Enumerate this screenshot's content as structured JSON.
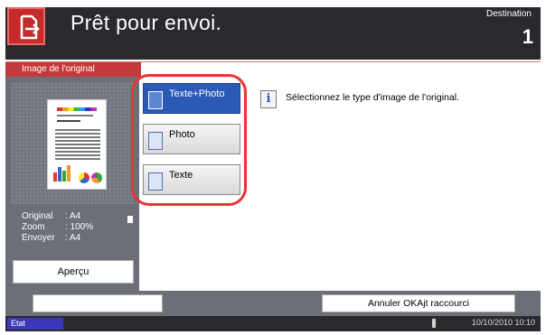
{
  "header": {
    "title": "Prêt pour envoi.",
    "destination_label": "Destination",
    "destination_count": "1"
  },
  "section": {
    "title": "Image de l'original"
  },
  "preview": {
    "info": [
      {
        "label": "Original",
        "value": ": A4"
      },
      {
        "label": "Zoom",
        "value": ": 100%"
      },
      {
        "label": "Envoyer",
        "value": ": A4"
      }
    ],
    "apercu_label": "Aperçu"
  },
  "options": [
    {
      "label": "Texte+Photo",
      "selected": true
    },
    {
      "label": "Photo",
      "selected": false
    },
    {
      "label": "Texte",
      "selected": false
    }
  ],
  "message": {
    "icon": "info-icon",
    "text": "Sélectionnez le type d'image de l'original."
  },
  "footer": {
    "right_button_label": "Annuler OKAjt raccourci"
  },
  "status_bar": {
    "etat_label": "Etat",
    "datetime": "10/10/2010  10:10"
  },
  "colors": {
    "header_bg": "#2a2a2e",
    "accent_red": "#c43a3a",
    "selected_blue": "#2b59b6",
    "panel_gray": "#6d6f78",
    "highlight_ring": "#ee3333"
  }
}
